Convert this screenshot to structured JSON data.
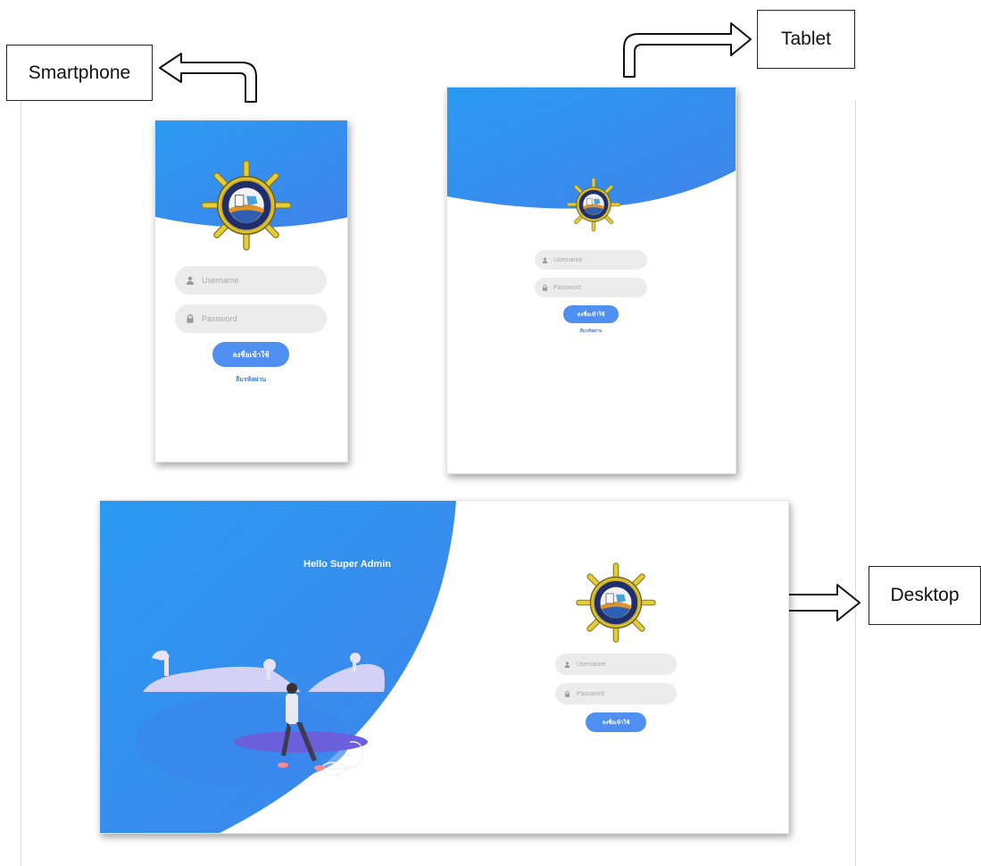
{
  "labels": {
    "smartphone": "Smartphone",
    "tablet": "Tablet",
    "desktop": "Desktop"
  },
  "smartphone": {
    "username_placeholder": "Username",
    "password_placeholder": "Password",
    "login_label": "ลงชื่อเข้าใช้",
    "register_link": "ลืมรหัสผ่าน"
  },
  "tablet": {
    "username_placeholder": "Username",
    "password_placeholder": "Password",
    "login_label": "ลงชื่อเข้าใช้",
    "register_link": "ลืมรหัสผ่าน"
  },
  "desktop": {
    "greeting": "Hello Super Admin",
    "username_placeholder": "Username",
    "password_placeholder": "Password",
    "login_label": "ลงชื่อเข้าใช้"
  },
  "colors": {
    "accent_blue": "#4f8ff2",
    "gradient_start": "#2a9af3",
    "gradient_end": "#4083ea",
    "field_bg": "#ececec",
    "link_blue": "#3f7fe6"
  }
}
